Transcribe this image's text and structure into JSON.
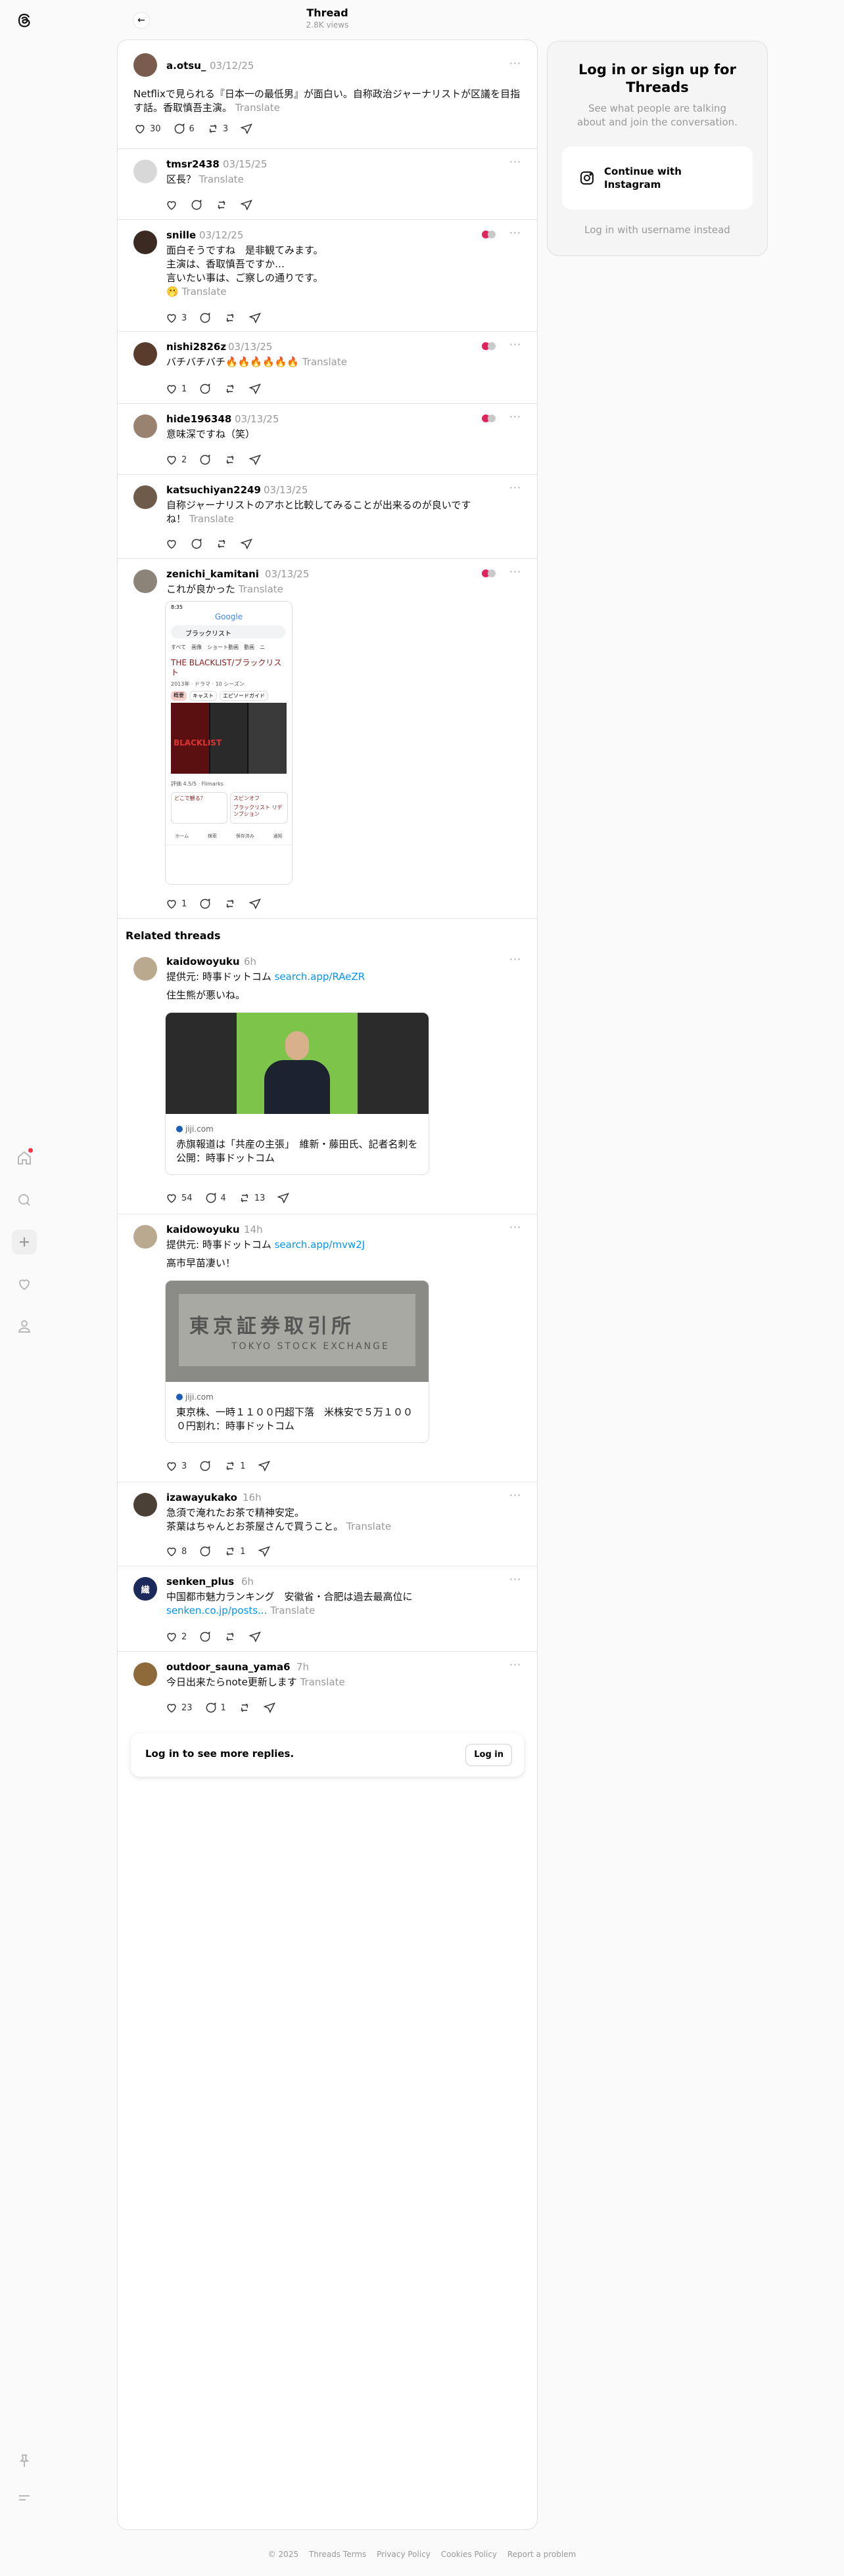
{
  "header": {
    "title": "Thread",
    "views": "2.8K views"
  },
  "icons": {
    "logo": "threads-logo-icon",
    "home": "home-icon",
    "search": "search-icon",
    "create": "plus-icon",
    "activity": "heart-icon",
    "profile": "person-icon",
    "pin": "pin-icon",
    "menu": "menu-icon",
    "back": "arrow-left-icon",
    "more": "more-icon",
    "like": "heart-icon",
    "reply": "comment-icon",
    "repost": "repost-icon",
    "share": "send-icon",
    "instagram": "instagram-icon"
  },
  "posts": [
    {
      "user": "a.otsu_",
      "date": "03/12/25",
      "text": "Netflixで見られる『日本一の最低男』が面白い。自称政治ジャーナリストが区議を目指す話。香取慎吾主演。",
      "translate": "Translate",
      "likes": "30",
      "replies": "6",
      "reposts": "3",
      "shares": ""
    },
    {
      "user": "tmsr2438",
      "date": "03/15/25",
      "text": "区長？",
      "translate": "Translate",
      "likes": "",
      "replies": "",
      "reposts": "",
      "shares": ""
    },
    {
      "user": "snille",
      "date": "03/12/25",
      "text": "面白そうですね　是非観てみます。\n主演は、香取慎吾ですか…\n言いたい事は、ご察しの通りです。\n🫢",
      "translate": "Translate",
      "likes": "3",
      "replies": "",
      "reposts": "",
      "shares": ""
    },
    {
      "user": "nishi2826z",
      "date": "03/13/25",
      "text": "バチバチバチ🔥🔥🔥🔥🔥🔥",
      "translate": "Translate",
      "likes": "1",
      "replies": "",
      "reposts": "",
      "shares": ""
    },
    {
      "user": "hide196348",
      "date": "03/13/25",
      "text": "意味深ですね（笑）",
      "translate": "",
      "likes": "2",
      "replies": "",
      "reposts": "",
      "shares": ""
    },
    {
      "user": "katsuchiyan2249",
      "date": "03/13/25",
      "text": "自称ジャーナリストのアホと比較してみることが出来るのが良いです ね！",
      "translate": "Translate",
      "likes": "",
      "replies": "",
      "reposts": "",
      "shares": ""
    },
    {
      "user": "zenichi_kamitani",
      "date": "03/13/25",
      "text": "これが良かった",
      "translate": "Translate",
      "likes": "1",
      "replies": "",
      "reposts": "",
      "shares": ""
    }
  ],
  "phone_shot": {
    "status_time": "8:35",
    "google": "Google",
    "query": "ブラックリスト",
    "tabs": [
      "すべて",
      "画像",
      "ショート動画",
      "動画",
      "ニ"
    ],
    "show_title": "THE BLACKLIST/ブラックリスト",
    "show_meta": "2013年 · ドラマ · 10 シーズン",
    "chips": [
      "概要",
      "キャスト",
      "エピソードガイド"
    ],
    "poster_text": "BLACKLIST",
    "rating": "評価 4.5/5 · Filmarks",
    "where": "どこで観る？",
    "service": "スピンオフ",
    "spinoff": "ブラックリスト リデンプション",
    "bottom": [
      "ホーム",
      "検索",
      "保存済み",
      "通知"
    ]
  },
  "related_title": "Related threads",
  "related": [
    {
      "user": "kaidowoyuku",
      "time": "6h",
      "source_prefix": "提供元: 時事ドットコム ",
      "source_link": "search.app/RAeZR",
      "text": "住生熊が悪いね。",
      "card_domain": "jiji.com",
      "card_title": "赤旗報道は「共産の主張」　維新・藤田氏、記者名刺を公開：時事ドットコム",
      "likes": "54",
      "replies": "4",
      "reposts": "13",
      "shares": ""
    },
    {
      "user": "kaidowoyuku",
      "time": "14h",
      "source_prefix": "提供元: 時事ドットコム ",
      "source_link": "search.app/mvw2J",
      "text": "高市早苗凄い！",
      "card_domain": "jiji.com",
      "card_title": "東京株、一時１１００円超下落　米株安で５万１００ ０円割れ：時事ドットコム",
      "card_sign": "東京証券取引所",
      "card_sign_en": "TOKYO STOCK EXCHANGE",
      "likes": "3",
      "replies": "",
      "reposts": "1",
      "shares": ""
    },
    {
      "user": "izawayukako",
      "time": "16h",
      "text": "急須で淹れたお茶で精神安定。\n茶葉はちゃんとお茶屋さんで買うこと。",
      "translate": "Translate",
      "likes": "8",
      "replies": "",
      "reposts": "1",
      "shares": ""
    },
    {
      "user": "senken_plus",
      "time": "6h",
      "avatar_text": "繊",
      "text_prefix": "中国都市魅力ランキング　安徽省・合肥は過去最高位に\n",
      "link": "senken.co.jp/posts...",
      "translate": "Translate",
      "likes": "2",
      "replies": "",
      "reposts": "",
      "shares": ""
    },
    {
      "user": "outdoor_sauna_yama6",
      "time": "7h",
      "text": "今日出来たらnote更新します",
      "translate": "Translate",
      "likes": "23",
      "replies": "1",
      "reposts": "",
      "shares": ""
    }
  ],
  "login_bar": {
    "text": "Log in to see more replies.",
    "button": "Log in"
  },
  "panel": {
    "title": "Log in or sign up for Threads",
    "subtitle": "See what people are talking about and join the conversation.",
    "instagram_button": "Continue with Instagram",
    "alt": "Log in with username instead"
  },
  "footer": [
    "© 2025",
    "Threads Terms",
    "Privacy Policy",
    "Cookies Policy",
    "Report a problem"
  ]
}
